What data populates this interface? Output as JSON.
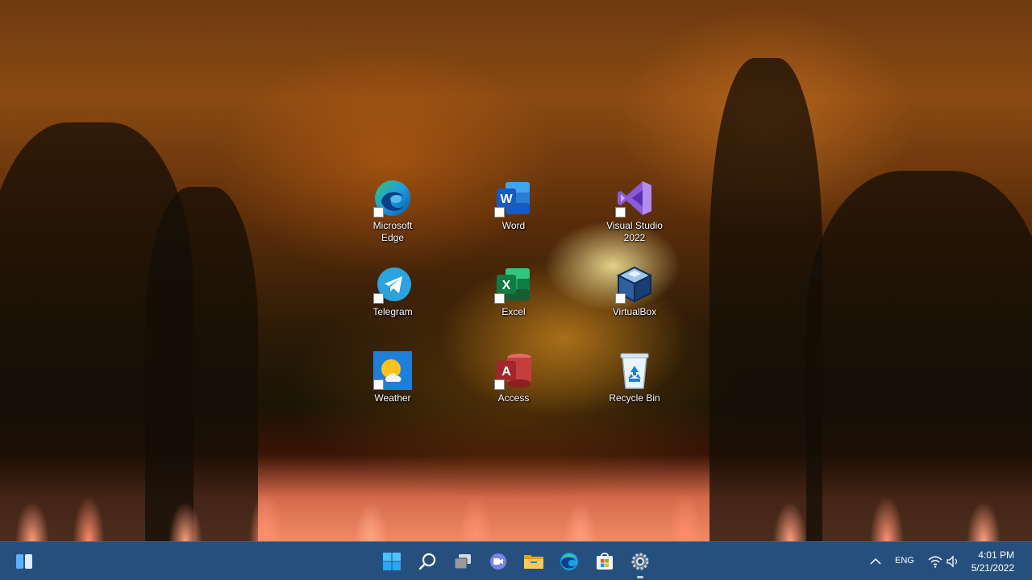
{
  "desktop": {
    "icons": [
      {
        "label": "Microsoft\nEdge",
        "name": "edge-icon"
      },
      {
        "label": "Word",
        "name": "word-icon"
      },
      {
        "label": "Visual Studio\n2022",
        "name": "visual-studio-icon"
      },
      {
        "label": "Telegram",
        "name": "telegram-icon"
      },
      {
        "label": "Excel",
        "name": "excel-icon"
      },
      {
        "label": "VirtualBox",
        "name": "virtualbox-icon"
      },
      {
        "label": "Weather",
        "name": "weather-icon"
      },
      {
        "label": "Access",
        "name": "access-icon"
      },
      {
        "label": "Recycle Bin",
        "name": "recycle-bin-icon"
      }
    ]
  },
  "taskbar": {
    "pinned": [
      "start-icon",
      "search-icon",
      "task-view-icon",
      "teams-chat-icon",
      "file-explorer-icon",
      "edge-icon",
      "microsoft-store-icon",
      "settings-icon"
    ],
    "tray": {
      "language": "ENG",
      "time": "4:01 PM",
      "date": "5/21/2022"
    },
    "accent": "#25507e"
  }
}
